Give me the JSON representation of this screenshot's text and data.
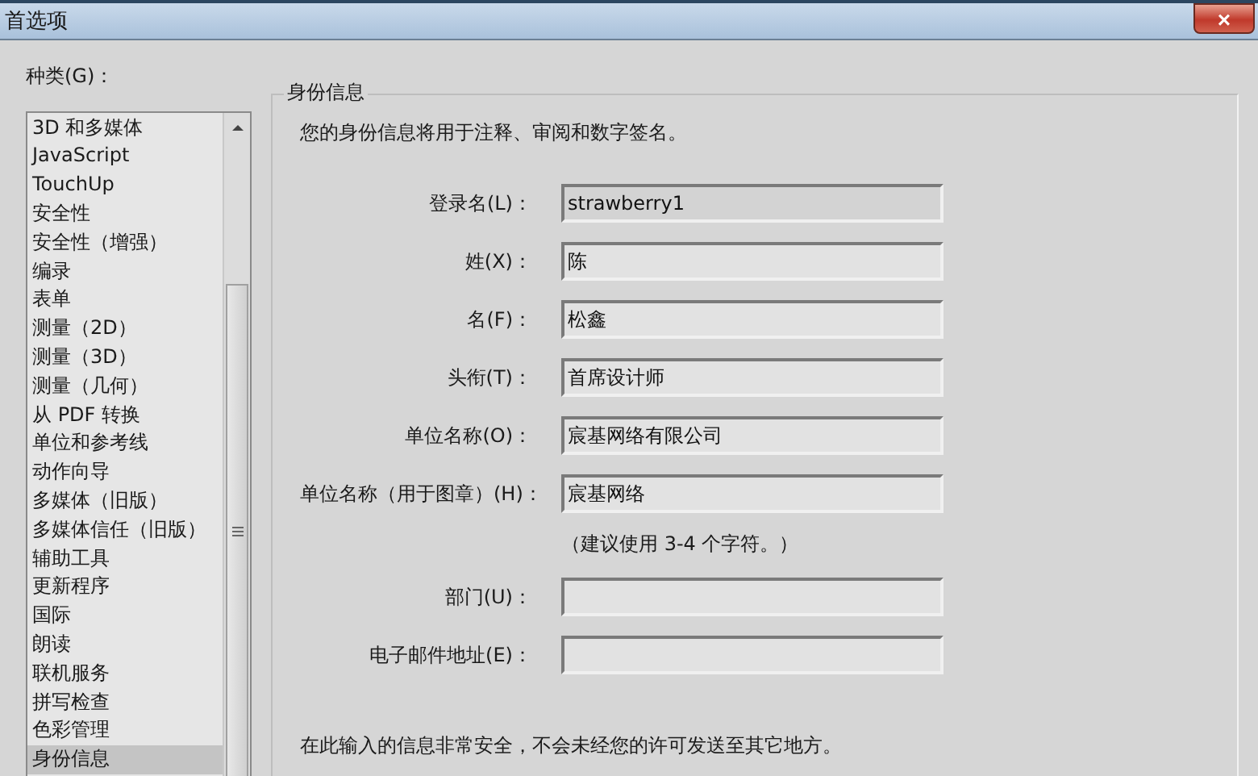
{
  "window": {
    "title": "首选项",
    "close": "×"
  },
  "categories": {
    "label": "种类(G)：",
    "items": [
      {
        "label": "3D 和多媒体",
        "selected": false
      },
      {
        "label": "JavaScript",
        "selected": false
      },
      {
        "label": "TouchUp",
        "selected": false
      },
      {
        "label": "安全性",
        "selected": false
      },
      {
        "label": "安全性（增强）",
        "selected": false
      },
      {
        "label": "编录",
        "selected": false
      },
      {
        "label": "表单",
        "selected": false
      },
      {
        "label": "测量（2D）",
        "selected": false
      },
      {
        "label": "测量（3D）",
        "selected": false
      },
      {
        "label": "测量（几何）",
        "selected": false
      },
      {
        "label": "从 PDF 转换",
        "selected": false
      },
      {
        "label": "单位和参考线",
        "selected": false
      },
      {
        "label": "动作向导",
        "selected": false
      },
      {
        "label": "多媒体（旧版）",
        "selected": false
      },
      {
        "label": "多媒体信任（旧版）",
        "selected": false
      },
      {
        "label": "辅助工具",
        "selected": false
      },
      {
        "label": "更新程序",
        "selected": false
      },
      {
        "label": "国际",
        "selected": false
      },
      {
        "label": "朗读",
        "selected": false
      },
      {
        "label": "联机服务",
        "selected": false
      },
      {
        "label": "拼写检查",
        "selected": false
      },
      {
        "label": "色彩管理",
        "selected": false
      },
      {
        "label": "身份信息",
        "selected": true
      }
    ]
  },
  "identity": {
    "title": "身份信息",
    "description": "您的身份信息将用于注释、审阅和数字签名。",
    "fields": [
      {
        "label": "登录名(L)：",
        "value": "strawberry1",
        "disabled": true
      },
      {
        "label": "姓(X)：",
        "value": "陈",
        "disabled": false
      },
      {
        "label": "名(F)：",
        "value": "松鑫",
        "disabled": false
      },
      {
        "label": "头衔(T)：",
        "value": "首席设计师",
        "disabled": false
      },
      {
        "label": "单位名称(O)：",
        "value": "宸基网络有限公司",
        "disabled": false
      },
      {
        "label": "单位名称（用于图章）(H)：",
        "value": "宸基网络",
        "disabled": false,
        "hint": "（建议使用 3-4 个字符。）"
      },
      {
        "label": "部门(U)：",
        "disabled": false
      },
      {
        "label": "电子邮件地址(E)：",
        "disabled": false
      }
    ],
    "footer": "在此输入的信息非常安全，不会未经您的许可发送至其它地方。"
  }
}
